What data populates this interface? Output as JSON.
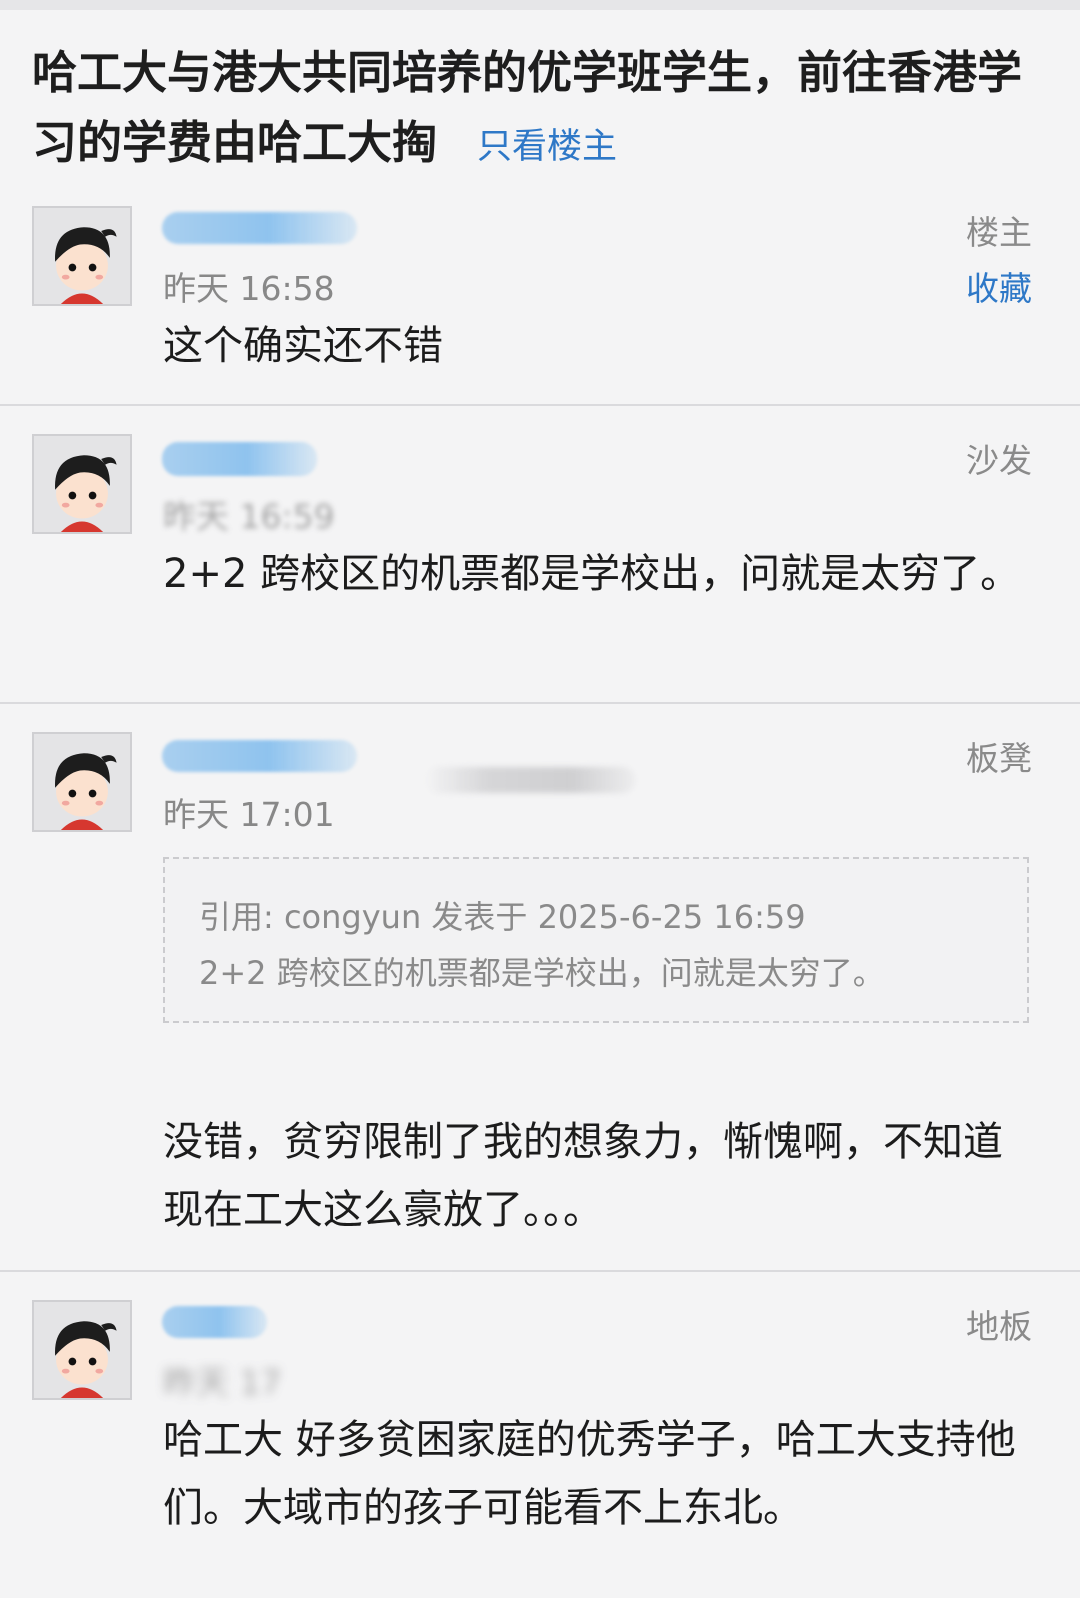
{
  "thread": {
    "title": "哈工大与港大共同培养的优学班学生，前往香港学习的学费由哈工大掏",
    "only_op_label": "只看楼主"
  },
  "posts": [
    {
      "floor_label": "楼主",
      "favorite_label": "收藏",
      "time": "昨天 16:58",
      "content": "这个确实还不错"
    },
    {
      "floor_label": "沙发",
      "time": "昨天 16:59",
      "content": "2+2 跨校区的机票都是学校出，问就是太穷了。"
    },
    {
      "floor_label": "板凳",
      "time": "昨天 17:01",
      "quote": {
        "header": "引用: congyun 发表于 2025-6-25 16:59",
        "text": "2+2 跨校区的机票都是学校出，问就是太穷了。"
      },
      "content": "没错，贫穷限制了我的想象力，惭愧啊，不知道现在工大这么豪放了。。。"
    },
    {
      "floor_label": "地板",
      "time": "昨天 17",
      "content": "哈工大 好多贫困家庭的优秀学子，哈工大支持他们。大域市的孩子可能看不上东北。"
    }
  ],
  "colors": {
    "link": "#2e78c7",
    "muted": "#888888",
    "background": "#f4f4f5"
  },
  "icons": {
    "avatar": "default-avatar-icon"
  }
}
